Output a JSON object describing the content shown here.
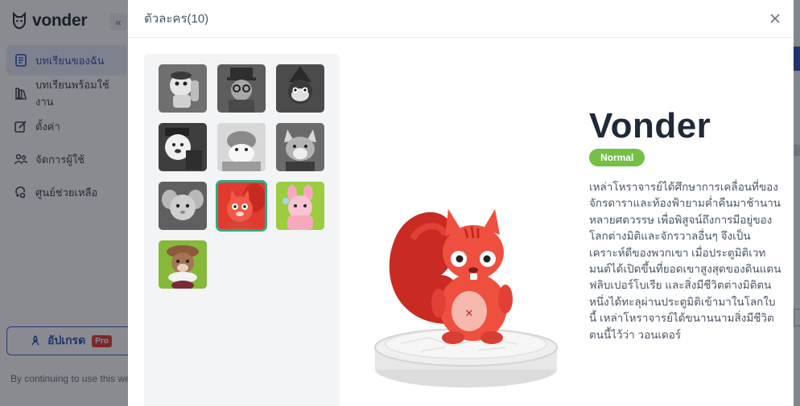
{
  "app": {
    "brand": "vonder",
    "collapse": "«"
  },
  "sidebar": {
    "items": [
      {
        "label": "บทเรียนของฉัน",
        "icon": "document-icon",
        "active": true
      },
      {
        "label": "บทเรียนพร้อมใช้งาน",
        "icon": "books-icon",
        "active": false
      },
      {
        "label": "ตั้งค่า",
        "icon": "edit-settings-icon",
        "active": false
      },
      {
        "label": "จัดการผู้ใช้",
        "icon": "users-icon",
        "active": false
      },
      {
        "label": "ศูนย์ช่วยเหลือ",
        "icon": "help-icon",
        "active": false
      }
    ],
    "upgrade_label": "อัปเกรด",
    "pro_badge": "Pro",
    "footer_note": "By continuing to use this we"
  },
  "modal": {
    "title": "ตัวละคร(10)",
    "close_icon": "close-icon",
    "characters": [
      {
        "name": "character-1",
        "state": "locked"
      },
      {
        "name": "character-2",
        "state": "locked"
      },
      {
        "name": "character-3",
        "state": "locked"
      },
      {
        "name": "character-4",
        "state": "locked"
      },
      {
        "name": "character-5",
        "state": "locked"
      },
      {
        "name": "character-6",
        "state": "locked"
      },
      {
        "name": "character-7",
        "state": "locked"
      },
      {
        "name": "vonder-squirrel",
        "state": "selected"
      },
      {
        "name": "character-9",
        "state": "unlocked"
      },
      {
        "name": "character-10",
        "state": "unlocked"
      }
    ],
    "selected": {
      "name": "Vonder",
      "rarity": "Normal",
      "description": "เหล่าโหราจารย์ได้ศึกษาการเคลื่อนที่ของจักรดาราและท้องฟ้ายามค่ำคืนมาช้านานหลายศตวรรษ เพื่อพิสูจน์ถึงการมีอยู่ของโลกต่างมิติและจักรวาลอื่นๆ จึงเป็นเคราะห์ดีของพวกเขา เมื่อประตูมิติเวทมนต์ได้เปิดขึ้นที่ยอดเขาสูงสุดของดินแดนฟลิบเปอร์โบเรีย และสิ่งมีชีวิตต่างมิติตนหนึ่งได้ทะลุผ่านประตูมิติเข้ามาในโลกใบนี้ เหล่าโหราจารย์ได้ขนานนามสิ่งมีชีวิตตนนี้ไว้ว่า วอนเดอร์"
    }
  },
  "colors": {
    "accent": "#2d4fb4",
    "rarity": "#74c044",
    "selected_outline": "#2eaa83",
    "squirrel": "#ef4f3f"
  }
}
